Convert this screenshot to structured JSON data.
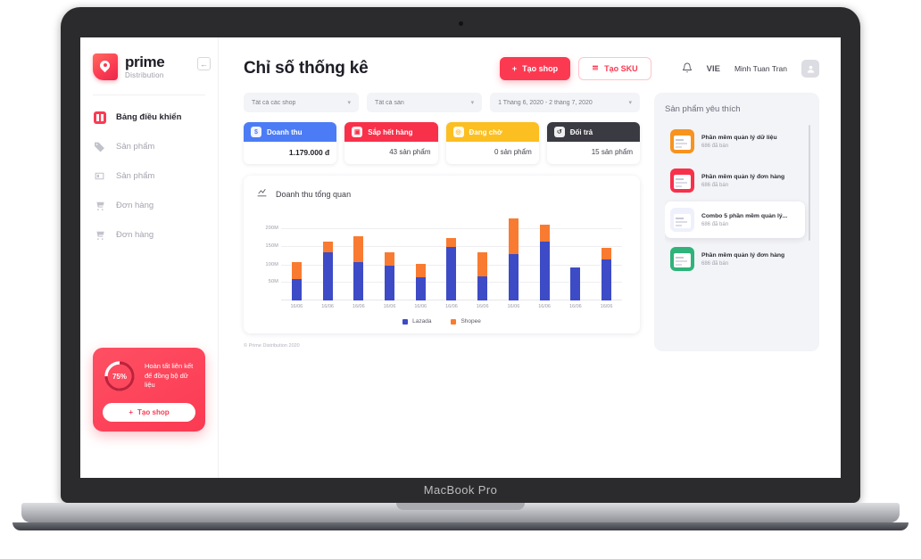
{
  "device": {
    "model_label": "MacBook Pro"
  },
  "sidebar": {
    "brand": {
      "name": "prime",
      "sub": "Distribution"
    },
    "collapse_icon": "collapse-left-icon",
    "items": [
      {
        "label": "Bảng điều khiển",
        "icon": "dashboard-icon",
        "active": true
      },
      {
        "label": "Sản phẩm",
        "icon": "tag-icon",
        "active": false
      },
      {
        "label": "Sản phẩm",
        "icon": "box-icon",
        "active": false
      },
      {
        "label": "Đơn hàng",
        "icon": "cart-icon",
        "active": false
      },
      {
        "label": "Đơn hàng",
        "icon": "cart-icon",
        "active": false
      }
    ],
    "promo": {
      "percent": 75,
      "percent_label": "75%",
      "text_line1": "Hoàn tất liên kết",
      "text_line2": "để đồng bộ dữ liệu",
      "button_label": "Tạo shop",
      "button_icon": "plus-icon"
    }
  },
  "header": {
    "title": "Chỉ số thống kê",
    "create_shop_label": "Tạo shop",
    "create_shop_icon": "plus-icon",
    "create_sku_label": "Tạo SKU",
    "create_sku_icon": "grid-icon",
    "bell_icon": "bell-icon",
    "language": "VIE",
    "user_name": "Minh Tuan Tran",
    "avatar_icon": "user-icon"
  },
  "filters": [
    {
      "name": "shop-filter",
      "value": "Tất cả các shop"
    },
    {
      "name": "product-filter",
      "value": "Tất cả sản"
    },
    {
      "name": "date-range-filter",
      "value": "1 Tháng 6, 2020 - 2 tháng 7, 2020"
    }
  ],
  "kpis": [
    {
      "title": "Doanh thu",
      "value": "1.179.000 đ",
      "color": "#4c7cf5",
      "icon": "dollar-icon",
      "emphasis": true
    },
    {
      "title": "Sắp hết hàng",
      "value": "43 sản phẩm",
      "color": "#f9304a",
      "icon": "image-icon",
      "emphasis": false
    },
    {
      "title": "Đang chờ",
      "value": "0 sản phẩm",
      "color": "#fcbf21",
      "icon": "clock-icon",
      "emphasis": false
    },
    {
      "title": "Đối trả",
      "value": "15 sản phẩm",
      "color": "#3a3a42",
      "icon": "return-icon",
      "emphasis": false
    }
  ],
  "chart_data": {
    "type": "bar",
    "title": "Doanh thu tổng quan",
    "title_icon": "chart-line-icon",
    "stacked": true,
    "xlabel": "",
    "ylabel": "",
    "ylim": [
      0,
      230
    ],
    "grid": true,
    "legend_position": "bottom",
    "ytick_labels": [
      "50M",
      "100M",
      "150M",
      "200M"
    ],
    "ytick_values": [
      50,
      100,
      150,
      200
    ],
    "categories": [
      "16/06",
      "16/06",
      "16/06",
      "16/06",
      "16/06",
      "16/06",
      "16/06",
      "16/06",
      "16/06",
      "16/06",
      "16/06"
    ],
    "series": [
      {
        "name": "Lazada",
        "color": "#3d4bc7",
        "values": [
          59,
          133,
          105,
          96,
          64,
          148,
          67,
          127,
          161,
          91,
          113
        ]
      },
      {
        "name": "Shopee",
        "color": "#f97b31",
        "values": [
          47,
          28,
          72,
          37,
          36,
          23,
          66,
          98,
          48,
          0,
          31
        ]
      }
    ],
    "totals": [
      106,
      161,
      177,
      133,
      100,
      171,
      133,
      225,
      209,
      91,
      144
    ]
  },
  "footer": {
    "copyright": "© Prime Distribution 2020"
  },
  "favorites": {
    "title": "Sản phẩm yêu thích",
    "items": [
      {
        "name": "Phần mềm quản lý dữ liệu",
        "sold": "686 đã bán",
        "color": "#f7931e",
        "selected": false
      },
      {
        "name": "Phần mềm quản lý đơn hàng",
        "sold": "686 đã bán",
        "color": "#f9304a",
        "selected": false
      },
      {
        "name": "Combo 5 phần mềm quản lý...",
        "sold": "686 đã bán",
        "color": "#eef1fb",
        "selected": true
      },
      {
        "name": "Phần mềm quản lý đơn hàng",
        "sold": "686 đã bán",
        "color": "#2fb37a",
        "selected": false
      }
    ]
  }
}
